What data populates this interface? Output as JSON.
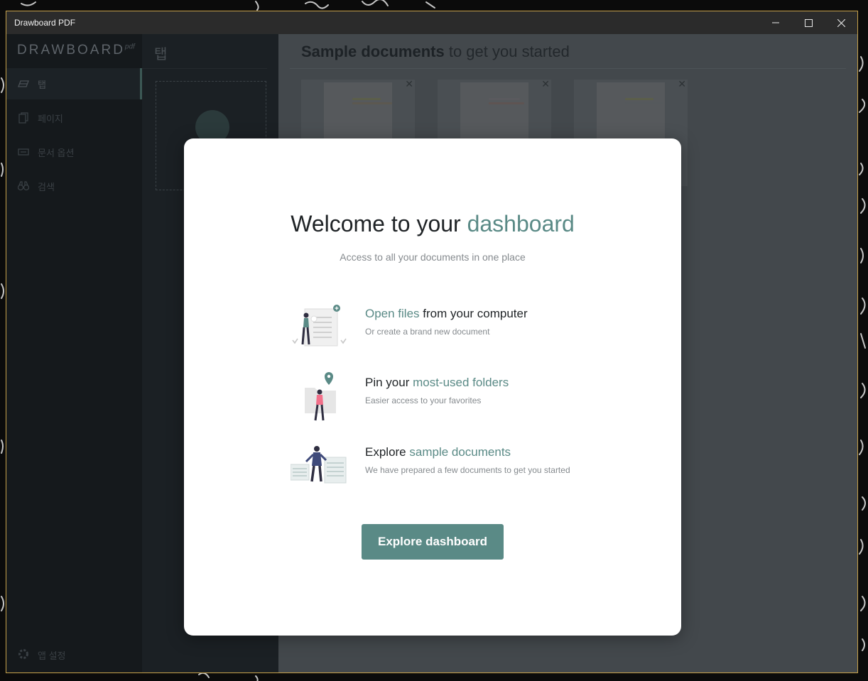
{
  "window": {
    "title": "Drawboard PDF"
  },
  "titlebar": {
    "minimize_icon": "minimize-icon",
    "maximize_icon": "maximize-icon",
    "close_icon": "close-icon"
  },
  "sidebar": {
    "logo": "DRAWBOARD",
    "logo_suffix": "pdf",
    "items": [
      {
        "label": "탭",
        "icon": "tabs-icon"
      },
      {
        "label": "페이지",
        "icon": "pages-icon"
      },
      {
        "label": "문서 옵션",
        "icon": "document-options-icon"
      },
      {
        "label": "검색",
        "icon": "search-binoculars-icon"
      }
    ],
    "settings_label": "앱 설정",
    "settings_icon": "gear-icon"
  },
  "tabs_panel": {
    "title": "탭"
  },
  "main": {
    "title_bold": "Sample documents",
    "title_rest": " to get you started"
  },
  "modal": {
    "title_prefix": "Welcome to your ",
    "title_accent": "dashboard",
    "subtitle": "Access to all your documents in one place",
    "features": [
      {
        "title_accent": "Open files",
        "title_rest": " from your computer",
        "desc": "Or create a brand new document"
      },
      {
        "title_prefix": "Pin your ",
        "title_accent": "most-used folders",
        "desc": "Easier access to your favorites"
      },
      {
        "title_prefix": "Explore ",
        "title_accent": "sample documents",
        "desc": "We have prepared a few documents to get you started"
      }
    ],
    "cta_label": "Explore dashboard"
  },
  "colors": {
    "accent": "#5a8a86",
    "window_border": "#c8a24a",
    "titlebar": "#2b2b2b"
  }
}
